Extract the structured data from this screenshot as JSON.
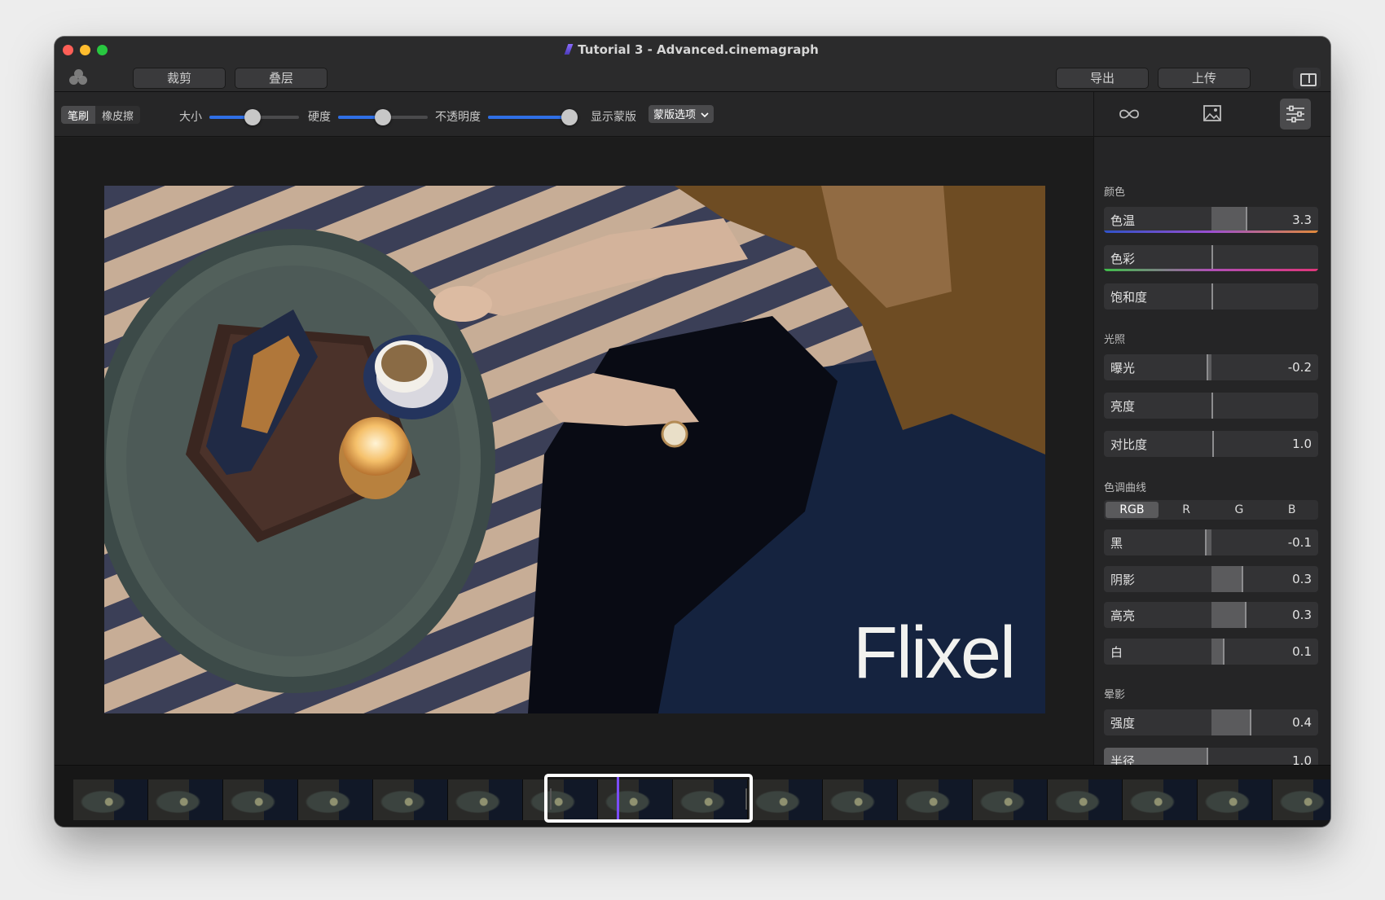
{
  "window": {
    "title": "Tutorial 3 - Advanced.cinemagraph"
  },
  "toolbar": {
    "crop_label": "裁剪",
    "layers_label": "叠层",
    "export_label": "导出",
    "upload_label": "上传"
  },
  "brush_bar": {
    "brush_label": "笔刷",
    "eraser_label": "橡皮擦",
    "size_label": "大小",
    "size_value": 0.48,
    "hardness_label": "硬度",
    "hardness_value": 0.5,
    "opacity_label": "不透明度",
    "opacity_value": 1.0,
    "show_mask_label": "显示蒙版",
    "mask_options_label": "蒙版选项"
  },
  "canvas": {
    "watermark": "Flixel"
  },
  "sidebar": {
    "tabs": [
      "loop-icon",
      "image-icon",
      "sliders-icon"
    ],
    "active_tab": "sliders-icon",
    "color_section": "颜色",
    "color": [
      {
        "label": "色温",
        "value": "3.3"
      },
      {
        "label": "色彩",
        "value": ""
      },
      {
        "label": "饱和度",
        "value": ""
      }
    ],
    "light_section": "光照",
    "light": [
      {
        "label": "曝光",
        "value": "-0.2"
      },
      {
        "label": "亮度",
        "value": ""
      },
      {
        "label": "对比度",
        "value": "1.0"
      }
    ],
    "curves_section": "色调曲线",
    "curve_channels": [
      "RGB",
      "R",
      "G",
      "B"
    ],
    "curve_active": "RGB",
    "curves": [
      {
        "label": "黑",
        "value": "-0.1"
      },
      {
        "label": "阴影",
        "value": "0.3"
      },
      {
        "label": "高亮",
        "value": "0.3"
      },
      {
        "label": "白",
        "value": "0.1"
      }
    ],
    "vignette_section": "晕影",
    "vignette": [
      {
        "label": "强度",
        "value": "0.4"
      },
      {
        "label": "半径",
        "value": "1.0"
      }
    ]
  },
  "colors": {
    "accent_blue": "#2f6fe6",
    "playhead_purple": "#7b4dff",
    "window_bg": "#1e1e1e"
  }
}
